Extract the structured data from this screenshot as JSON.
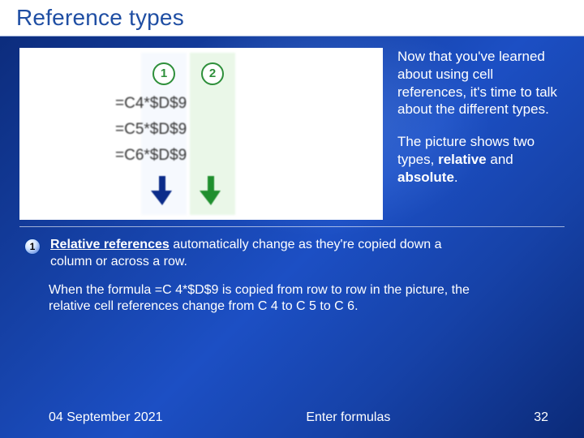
{
  "title": "Reference types",
  "picture": {
    "callouts": [
      "1",
      "2"
    ],
    "formulas": [
      "=C4*$D$9",
      "=C5*$D$9",
      "=C6*$D$9"
    ],
    "arrow_colors": [
      "#0b2c8a",
      "#1f8f2e"
    ]
  },
  "side": {
    "p1": "Now that you've learned about using cell references, it's time to talk about the different types.",
    "p2_a": "The picture shows two types, ",
    "p2_b": "relative",
    "p2_c": " and ",
    "p2_d": "absolute",
    "p2_e": "."
  },
  "bullet": {
    "num": "1",
    "line1_a": "Relative references",
    "line1_b": " automatically change as they're copied down a column or across a row.",
    "line2": "When the formula =C 4*$D$9 is copied from row to row in the picture, the relative cell references change from C 4 to C 5 to C 6."
  },
  "footer": {
    "date": "04 September 2021",
    "center": "Enter formulas",
    "page": "32"
  }
}
